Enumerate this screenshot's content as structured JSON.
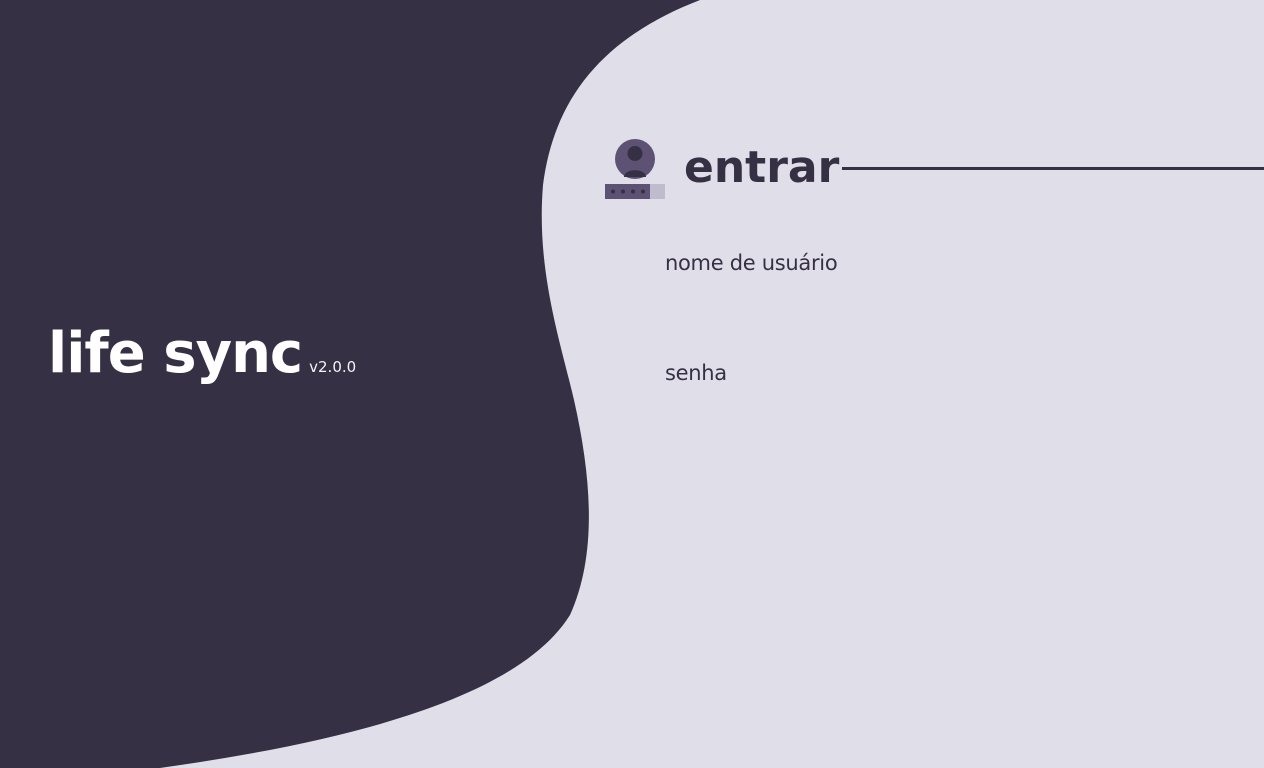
{
  "app": {
    "name": "life sync",
    "version": "v2.0.0"
  },
  "login": {
    "title": "entrar",
    "icon": "user-password-icon",
    "fields": {
      "username": {
        "label": "nome de usuário",
        "value": ""
      },
      "password": {
        "label": "senha",
        "value": ""
      }
    }
  },
  "colors": {
    "background": "#E0DEE9",
    "dark_panel": "#353044",
    "accent": "#5E5274",
    "brand_text": "#FFFFFF"
  }
}
